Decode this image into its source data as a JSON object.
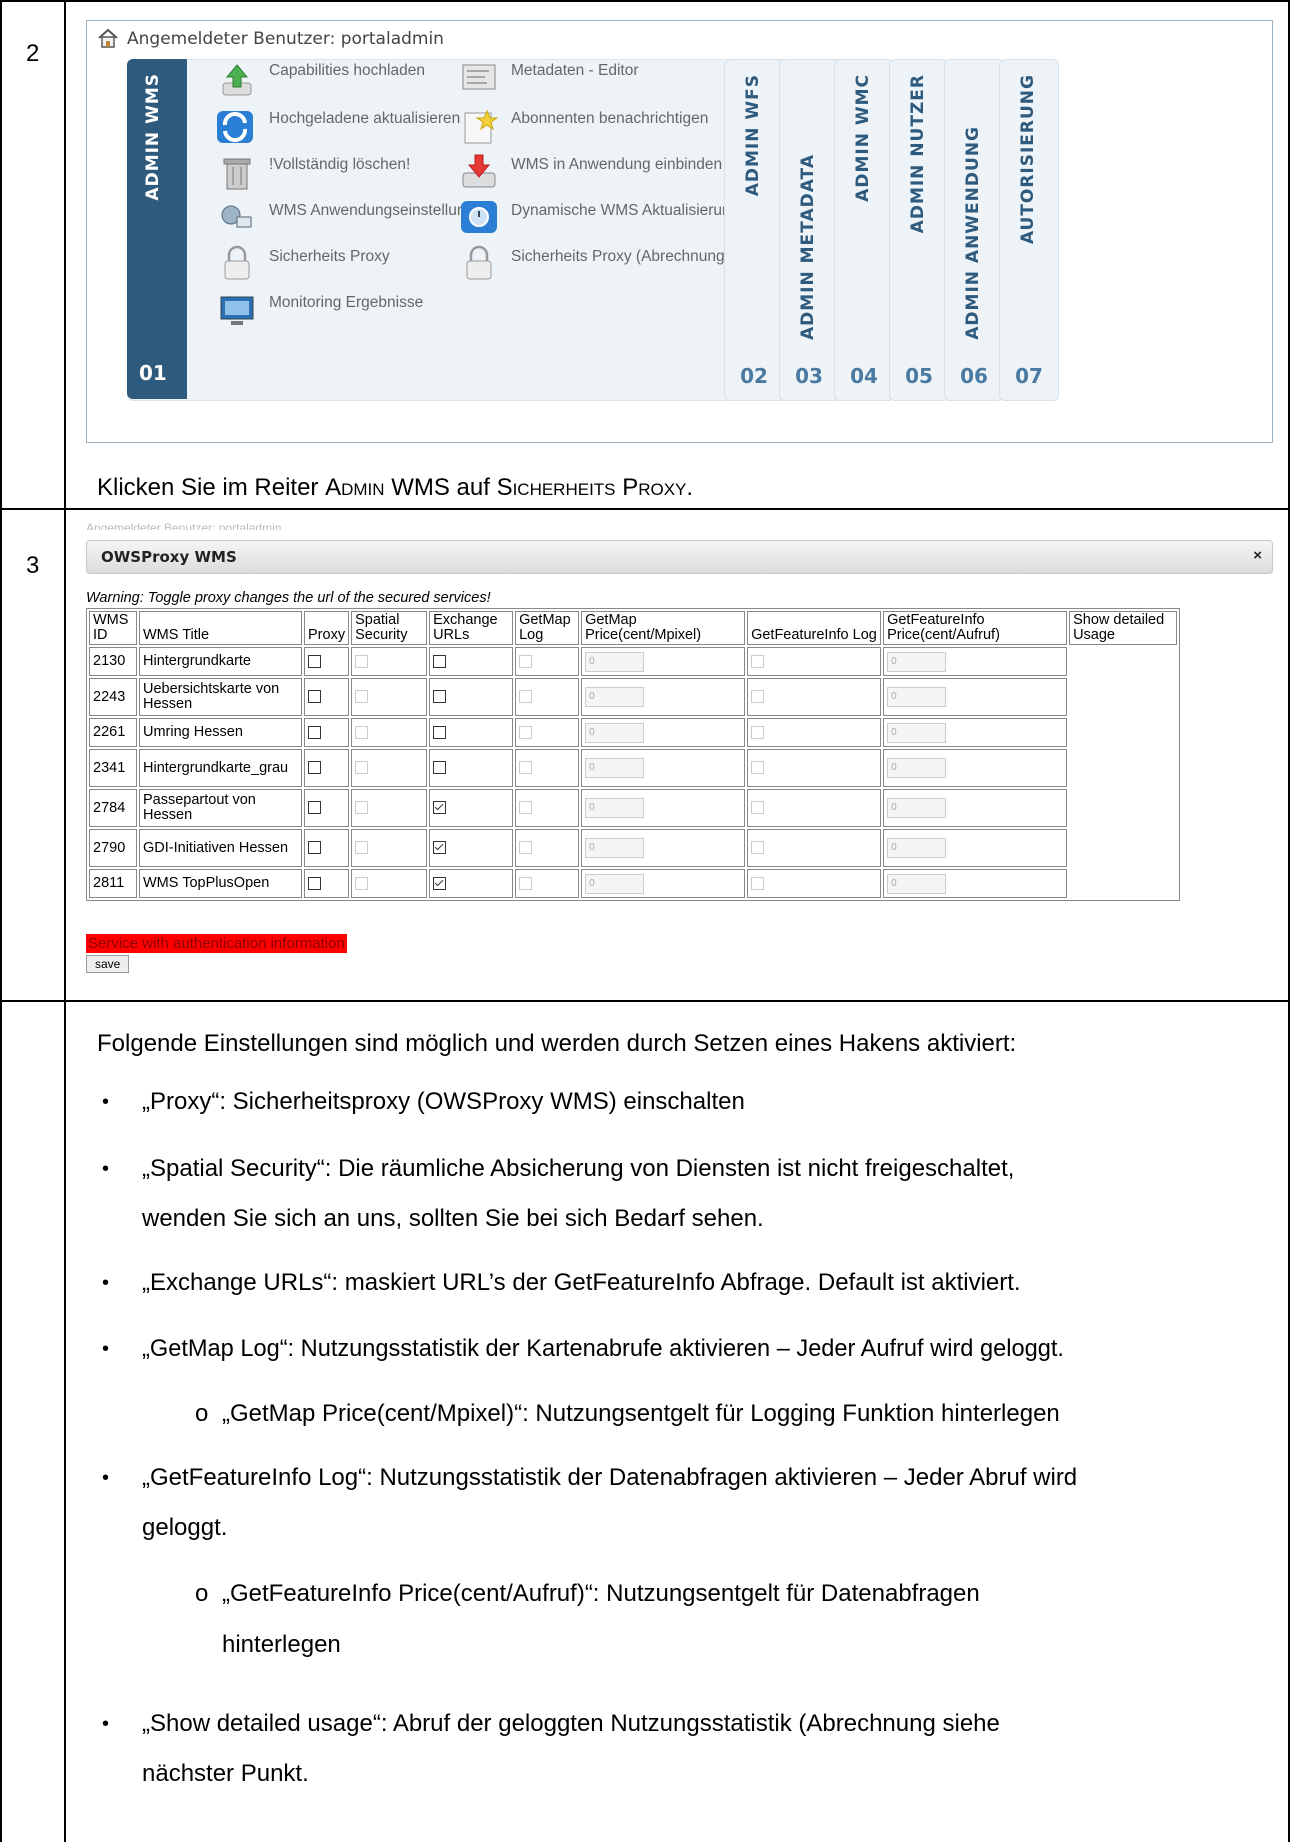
{
  "step2": {
    "number": "2",
    "user_label": "Angemeldeter Benutzer: portaladmin",
    "active_tab": {
      "label": "ADMIN WMS",
      "number": "01"
    },
    "items": [
      {
        "label": "Capabilities hochladen",
        "icon": "upload-icon"
      },
      {
        "label": "Metadaten - Editor",
        "icon": "metadata-editor-icon"
      },
      {
        "label": "Hochgeladene aktualisieren",
        "icon": "refresh-icon"
      },
      {
        "label": "Abonnenten benachrichtigen",
        "icon": "notify-icon"
      },
      {
        "label": "!Vollständig löschen!",
        "icon": "trash-icon"
      },
      {
        "label": "WMS in Anwendung einbinden",
        "icon": "embed-icon"
      },
      {
        "label": "WMS Anwendungseinstellungen",
        "icon": "settings-icon"
      },
      {
        "label": "Dynamische WMS Aktualisierung",
        "icon": "dynamic-refresh-icon"
      },
      {
        "label": "Sicherheits Proxy",
        "icon": "lock-icon"
      },
      {
        "label": "Sicherheits Proxy (Abrechnung)",
        "icon": "lock-icon"
      },
      {
        "label": "Monitoring Ergebnisse",
        "icon": "monitor-icon"
      }
    ],
    "side_tabs": [
      {
        "label": "ADMIN WFS",
        "number": "02"
      },
      {
        "label": "ADMIN METADATA",
        "number": "03"
      },
      {
        "label": "ADMIN WMC",
        "number": "04"
      },
      {
        "label": "ADMIN NUTZER",
        "number": "05"
      },
      {
        "label": "ADMIN ANWENDUNG",
        "number": "06"
      },
      {
        "label": "AUTORISIERUNG",
        "number": "07"
      }
    ],
    "caption_a": "Klicken Sie im Reiter ",
    "caption_b": "Admin",
    "caption_c": " WMS auf ",
    "caption_d": "Sicherheits Proxy",
    "caption_e": "."
  },
  "step3": {
    "number": "3",
    "ghost_text": "Angemeldeter Benutzer: portaladmin",
    "dialog_title": "OWSProxy WMS",
    "close": "×",
    "warning": "Warning: Toggle proxy changes the url of the secured services!",
    "headers": [
      "WMS ID",
      "WMS Title",
      "Proxy",
      "Spatial Security",
      "Exchange URLs",
      "GetMap Log",
      "GetMap Price(cent/Mpixel)",
      "GetFeatureInfo Log",
      "GetFeatureInfo Price(cent/Aufruf)",
      "Show detailed Usage"
    ],
    "rows": [
      {
        "id": "2130",
        "title": "Hintergrundkarte",
        "exchange": false,
        "getmap_price": "0",
        "gfi_price": "0"
      },
      {
        "id": "2243",
        "title": "Uebersichtskarte von Hessen",
        "exchange": false,
        "getmap_price": "0",
        "gfi_price": "0"
      },
      {
        "id": "2261",
        "title": "Umring Hessen",
        "exchange": false,
        "getmap_price": "0",
        "gfi_price": "0"
      },
      {
        "id": "2341",
        "title": "Hintergrundkarte_grau",
        "exchange": false,
        "getmap_price": "0",
        "gfi_price": "0"
      },
      {
        "id": "2784",
        "title": "Passepartout von Hessen",
        "exchange": true,
        "getmap_price": "0",
        "gfi_price": "0"
      },
      {
        "id": "2790",
        "title": "GDI-Initiativen Hessen",
        "exchange": true,
        "getmap_price": "0",
        "gfi_price": "0"
      },
      {
        "id": "2811",
        "title": "WMS TopPlusOpen",
        "exchange": true,
        "getmap_price": "0",
        "gfi_price": "0"
      }
    ],
    "auth_info": "Service with authentication information",
    "save_label": "save"
  },
  "notes": {
    "intro": "Folgende Einstellungen sind möglich und werden durch Setzen eines Hakens aktiviert:",
    "b1": "„Proxy“: Sicherheitsproxy (OWSProxy WMS) einschalten",
    "b2_l1": "„Spatial Security“: Die räumliche Absicherung von Diensten ist nicht freigeschaltet,",
    "b2_l2": "wenden Sie sich an uns, sollten Sie bei sich Bedarf sehen.",
    "b3": "„Exchange URLs“: maskiert URL’s der GetFeatureInfo Abfrage. Default ist aktiviert.",
    "b4": "„GetMap Log“: Nutzungsstatistik der Kartenabrufe aktivieren – Jeder Aufruf wird geloggt.",
    "b4_sub": "„GetMap Price(cent/Mpixel)“: Nutzungsentgelt für Logging Funktion hinterlegen",
    "b5_l1": "„GetFeatureInfo Log“: Nutzungsstatistik der Datenabfragen aktivieren – Jeder Abruf wird",
    "b5_l2": "geloggt.",
    "b5_sub_l1": "„GetFeatureInfo Price(cent/Aufruf)“: Nutzungsentgelt für Datenabfragen",
    "b5_sub_l2": "hinterlegen",
    "b6_l1": "„Show detailed usage“: Abruf der geloggten Nutzungsstatistik (Abrechnung siehe",
    "b6_l2": "nächster Punkt.",
    "bullet": "•",
    "sub_bullet": "o"
  }
}
